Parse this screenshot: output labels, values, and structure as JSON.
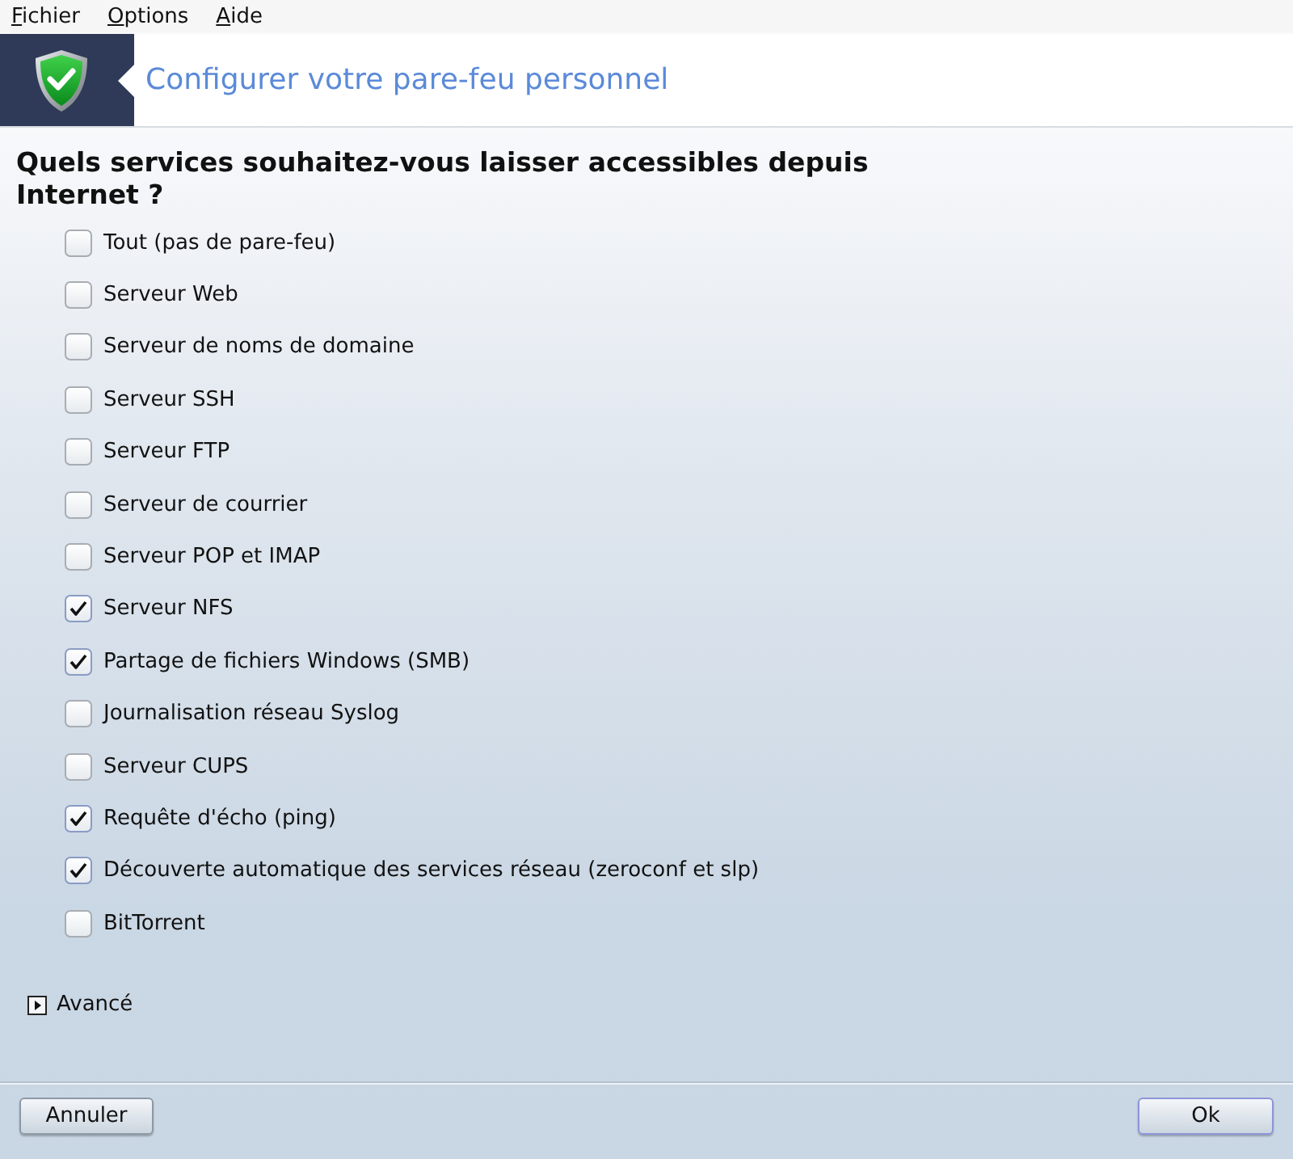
{
  "menu": [
    {
      "label": "Fichier"
    },
    {
      "label": "Options"
    },
    {
      "label": "Aide"
    }
  ],
  "header": {
    "title": "Configurer votre pare-feu personnel"
  },
  "question": "Quels services souhaitez-vous laisser accessibles depuis Internet ?",
  "services": [
    {
      "label": "Tout (pas de pare-feu)",
      "checked": false
    },
    {
      "label": "Serveur Web",
      "checked": false
    },
    {
      "label": "Serveur de noms de domaine",
      "checked": false
    },
    {
      "label": "Serveur SSH",
      "checked": false
    },
    {
      "label": "Serveur FTP",
      "checked": false
    },
    {
      "label": "Serveur de courrier",
      "checked": false
    },
    {
      "label": "Serveur POP et IMAP",
      "checked": false
    },
    {
      "label": "Serveur NFS",
      "checked": true
    },
    {
      "label": "Partage de fichiers Windows (SMB)",
      "checked": true
    },
    {
      "label": "Journalisation réseau Syslog",
      "checked": false
    },
    {
      "label": "Serveur CUPS",
      "checked": false
    },
    {
      "label": "Requête d'écho (ping)",
      "checked": true
    },
    {
      "label": "Découverte automatique des services réseau (zeroconf et slp)",
      "checked": true
    },
    {
      "label": "BitTorrent",
      "checked": false
    }
  ],
  "advanced": {
    "label": "Avancé",
    "expanded": false
  },
  "buttons": [
    {
      "label": "Annuler",
      "default": false
    },
    {
      "label": "Ok",
      "default": true
    }
  ]
}
